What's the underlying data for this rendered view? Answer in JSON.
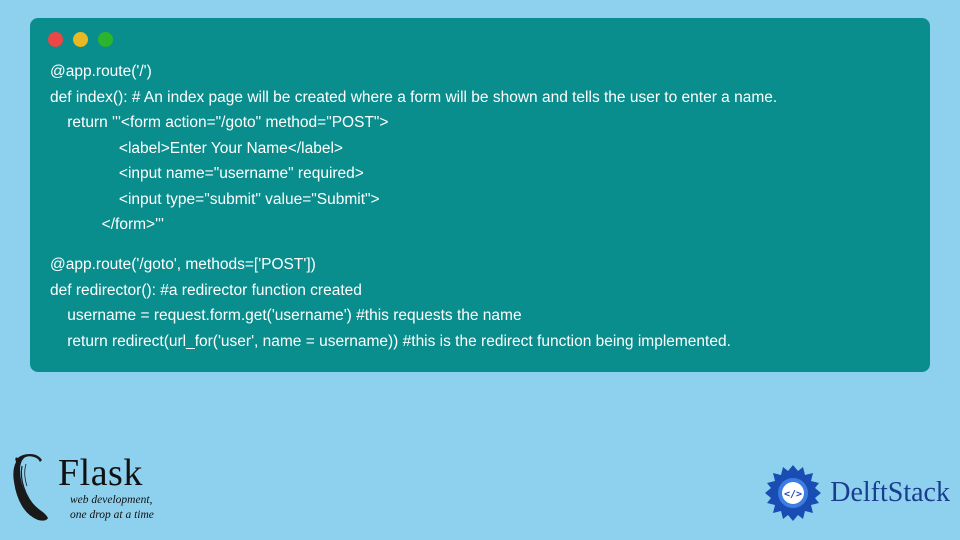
{
  "code": {
    "line1": "@app.route('/')",
    "line2": "def index(): # An index page will be created where a form will be shown and tells the user to enter a name.",
    "line3": "    return '''<form action=\"/goto\" method=\"POST\">",
    "line4": "                <label>Enter Your Name</label>",
    "line5": "                <input name=\"username\" required>",
    "line6": "                <input type=\"submit\" value=\"Submit\">",
    "line7": "            </form>'''",
    "line8": "@app.route('/goto', methods=['POST'])",
    "line9": "def redirector(): #a redirector function created",
    "line10": "    username = request.form.get('username') #this requests the name",
    "line11": "    return redirect(url_for('user', name = username)) #this is the redirect function being implemented."
  },
  "flask": {
    "title": "Flask",
    "sub1": "web development,",
    "sub2": "one drop at a time"
  },
  "delft": {
    "text": "DelftStack"
  }
}
